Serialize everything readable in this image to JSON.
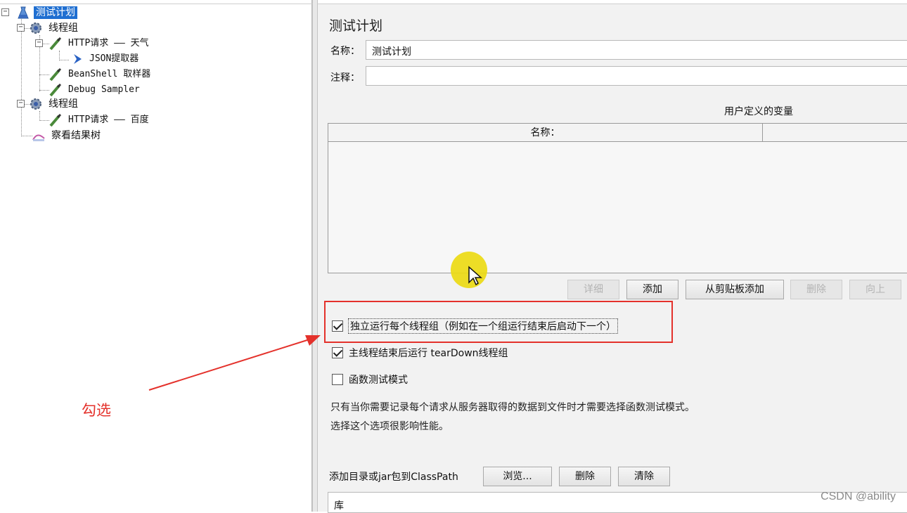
{
  "tree": {
    "root": "测试计划",
    "group1": "线程组",
    "http_weather": "HTTP请求 —— 天气",
    "json_extractor": "JSON提取器",
    "beanshell": "BeanShell 取样器",
    "debug": "Debug Sampler",
    "group2": "线程组",
    "http_baidu": "HTTP请求 —— 百度",
    "result_tree": "察看结果树"
  },
  "panel": {
    "title": "测试计划",
    "name_label": "名称：",
    "name_value": "测试计划",
    "comment_label": "注释：",
    "comment_value": "",
    "vars_title": "用户定义的变量",
    "col_name": "名称：",
    "buttons": {
      "detail": "详细",
      "add": "添加",
      "add_clipboard": "从剪贴板添加",
      "delete": "删除",
      "up": "向上"
    },
    "opt_independent": "独立运行每个线程组（例如在一个组运行结束后启动下一个）",
    "opt_teardown": "主线程结束后运行 tearDown线程组",
    "opt_functional": "函数测试模式",
    "note_line1": "只有当你需要记录每个请求从服务器取得的数据到文件时才需要选择函数测试模式。",
    "note_line2": "选择这个选项很影响性能。",
    "classpath_label": "添加目录或jar包到ClassPath",
    "browse": "浏览...",
    "remove": "删除",
    "clear": "清除",
    "lib_header": "库"
  },
  "checks": {
    "independent": true,
    "teardown": true,
    "functional": false
  },
  "annotation": {
    "text": "勾选",
    "color": "#e4312b"
  },
  "watermark": "CSDN @ability"
}
